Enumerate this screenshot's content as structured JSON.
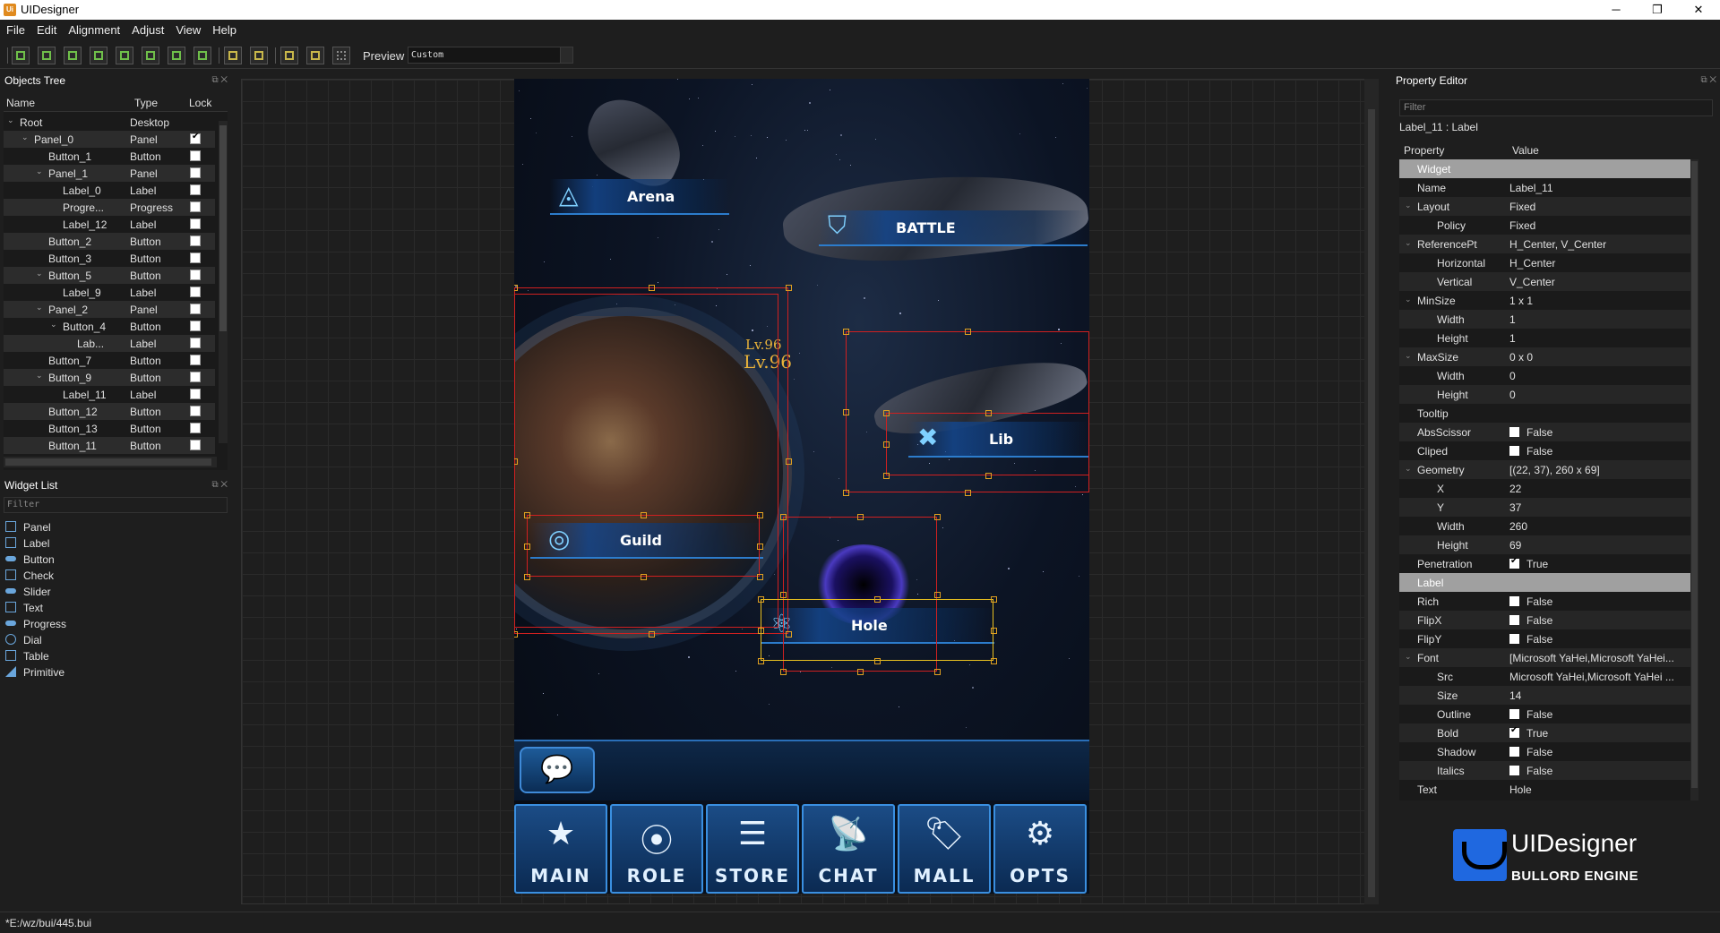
{
  "window": {
    "title": "UIDesigner",
    "app_icon": "Ui"
  },
  "menu": [
    "File",
    "Edit",
    "Alignment",
    "Adjust",
    "View",
    "Help"
  ],
  "toolbar": {
    "preview_label": "Preview",
    "preview_value": "Custom"
  },
  "objects_tree": {
    "title": "Objects Tree",
    "columns": [
      "Name",
      "Type",
      "Lock"
    ],
    "rows": [
      {
        "name": "Root",
        "type": "Desktop",
        "depth": 0,
        "expander": "open",
        "checkbox": null
      },
      {
        "name": "Panel_0",
        "type": "Panel",
        "depth": 1,
        "expander": "open",
        "checkbox": true
      },
      {
        "name": "Button_1",
        "type": "Button",
        "depth": 2,
        "expander": null,
        "checkbox": false
      },
      {
        "name": "Panel_1",
        "type": "Panel",
        "depth": 2,
        "expander": "open",
        "checkbox": false
      },
      {
        "name": "Label_0",
        "type": "Label",
        "depth": 3,
        "expander": null,
        "checkbox": false
      },
      {
        "name": "Progre...",
        "type": "Progress",
        "depth": 3,
        "expander": null,
        "checkbox": false
      },
      {
        "name": "Label_12",
        "type": "Label",
        "depth": 3,
        "expander": null,
        "checkbox": false
      },
      {
        "name": "Button_2",
        "type": "Button",
        "depth": 2,
        "expander": null,
        "checkbox": false
      },
      {
        "name": "Button_3",
        "type": "Button",
        "depth": 2,
        "expander": null,
        "checkbox": false
      },
      {
        "name": "Button_5",
        "type": "Button",
        "depth": 2,
        "expander": "open",
        "checkbox": false
      },
      {
        "name": "Label_9",
        "type": "Label",
        "depth": 3,
        "expander": null,
        "checkbox": false
      },
      {
        "name": "Panel_2",
        "type": "Panel",
        "depth": 2,
        "expander": "open",
        "checkbox": false
      },
      {
        "name": "Button_4",
        "type": "Button",
        "depth": 3,
        "expander": "open",
        "checkbox": false
      },
      {
        "name": "Lab...",
        "type": "Label",
        "depth": 4,
        "expander": null,
        "checkbox": false
      },
      {
        "name": "Button_7",
        "type": "Button",
        "depth": 2,
        "expander": null,
        "checkbox": false
      },
      {
        "name": "Button_9",
        "type": "Button",
        "depth": 2,
        "expander": "open",
        "checkbox": false
      },
      {
        "name": "Label_11",
        "type": "Label",
        "depth": 3,
        "expander": null,
        "checkbox": false
      },
      {
        "name": "Button_12",
        "type": "Button",
        "depth": 2,
        "expander": null,
        "checkbox": false
      },
      {
        "name": "Button_13",
        "type": "Button",
        "depth": 2,
        "expander": null,
        "checkbox": false
      },
      {
        "name": "Button_11",
        "type": "Button",
        "depth": 2,
        "expander": null,
        "checkbox": false
      }
    ]
  },
  "widget_list": {
    "title": "Widget List",
    "filter_placeholder": "Filter",
    "items": [
      "Panel",
      "Label",
      "Button",
      "Check",
      "Slider",
      "Text",
      "Progress",
      "Dial",
      "Table",
      "Primitive"
    ]
  },
  "preview": {
    "buttons": [
      "Arena",
      "BATTLE",
      "Lib",
      "Guild",
      "Hole"
    ],
    "level_small": "Lv.96",
    "level_large": "Lv.96",
    "nav": [
      "MAIN",
      "ROLE",
      "STORE",
      "CHAT",
      "MALL",
      "OPTS"
    ]
  },
  "property_editor": {
    "title": "Property Editor",
    "filter_placeholder": "Filter",
    "object": "Label_11 : Label",
    "columns": [
      "Property",
      "Value"
    ],
    "rows": [
      {
        "k": "Widget",
        "v": "",
        "kind": "group"
      },
      {
        "k": "Name",
        "v": "Label_11",
        "indent": 1
      },
      {
        "k": "Layout",
        "v": "Fixed",
        "indent": 1,
        "exp": true
      },
      {
        "k": "Policy",
        "v": "Fixed",
        "indent": 2
      },
      {
        "k": "ReferencePt",
        "v": "H_Center, V_Center",
        "indent": 1,
        "exp": true
      },
      {
        "k": "Horizontal",
        "v": "H_Center",
        "indent": 2
      },
      {
        "k": "Vertical",
        "v": "V_Center",
        "indent": 2
      },
      {
        "k": "MinSize",
        "v": "1 x 1",
        "indent": 1,
        "exp": true
      },
      {
        "k": "Width",
        "v": "1",
        "indent": 2
      },
      {
        "k": "Height",
        "v": "1",
        "indent": 2
      },
      {
        "k": "MaxSize",
        "v": "0 x 0",
        "indent": 1,
        "exp": true
      },
      {
        "k": "Width",
        "v": "0",
        "indent": 2
      },
      {
        "k": "Height",
        "v": "0",
        "indent": 2
      },
      {
        "k": "Tooltip",
        "v": "",
        "indent": 1
      },
      {
        "k": "AbsScissor",
        "v": "False",
        "indent": 1,
        "check": false
      },
      {
        "k": "Cliped",
        "v": "False",
        "indent": 1,
        "check": false
      },
      {
        "k": "Geometry",
        "v": "[(22, 37), 260 x 69]",
        "indent": 1,
        "exp": true
      },
      {
        "k": "X",
        "v": "22",
        "indent": 2
      },
      {
        "k": "Y",
        "v": "37",
        "indent": 2
      },
      {
        "k": "Width",
        "v": "260",
        "indent": 2
      },
      {
        "k": "Height",
        "v": "69",
        "indent": 2
      },
      {
        "k": "Penetration",
        "v": "True",
        "indent": 1,
        "check": true
      },
      {
        "k": "Label",
        "v": "",
        "kind": "group"
      },
      {
        "k": "Rich",
        "v": "False",
        "indent": 1,
        "check": false
      },
      {
        "k": "FlipX",
        "v": "False",
        "indent": 1,
        "check": false
      },
      {
        "k": "FlipY",
        "v": "False",
        "indent": 1,
        "check": false
      },
      {
        "k": "Font",
        "v": "[Microsoft YaHei,Microsoft YaHei...",
        "indent": 1,
        "exp": true
      },
      {
        "k": "Src",
        "v": "Microsoft YaHei,Microsoft YaHei ...",
        "indent": 2
      },
      {
        "k": "Size",
        "v": "14",
        "indent": 2
      },
      {
        "k": "Outline",
        "v": "False",
        "indent": 2,
        "check": false
      },
      {
        "k": "Bold",
        "v": "True",
        "indent": 2,
        "check": true
      },
      {
        "k": "Shadow",
        "v": "False",
        "indent": 2,
        "check": false
      },
      {
        "k": "Italics",
        "v": "False",
        "indent": 2,
        "check": false
      },
      {
        "k": "Text",
        "v": "Hole",
        "indent": 1
      }
    ]
  },
  "brand": {
    "name": "UIDesigner",
    "sub": "BULLORD ENGINE"
  },
  "status": {
    "path": "*E:/wz/bui/445.bui"
  }
}
